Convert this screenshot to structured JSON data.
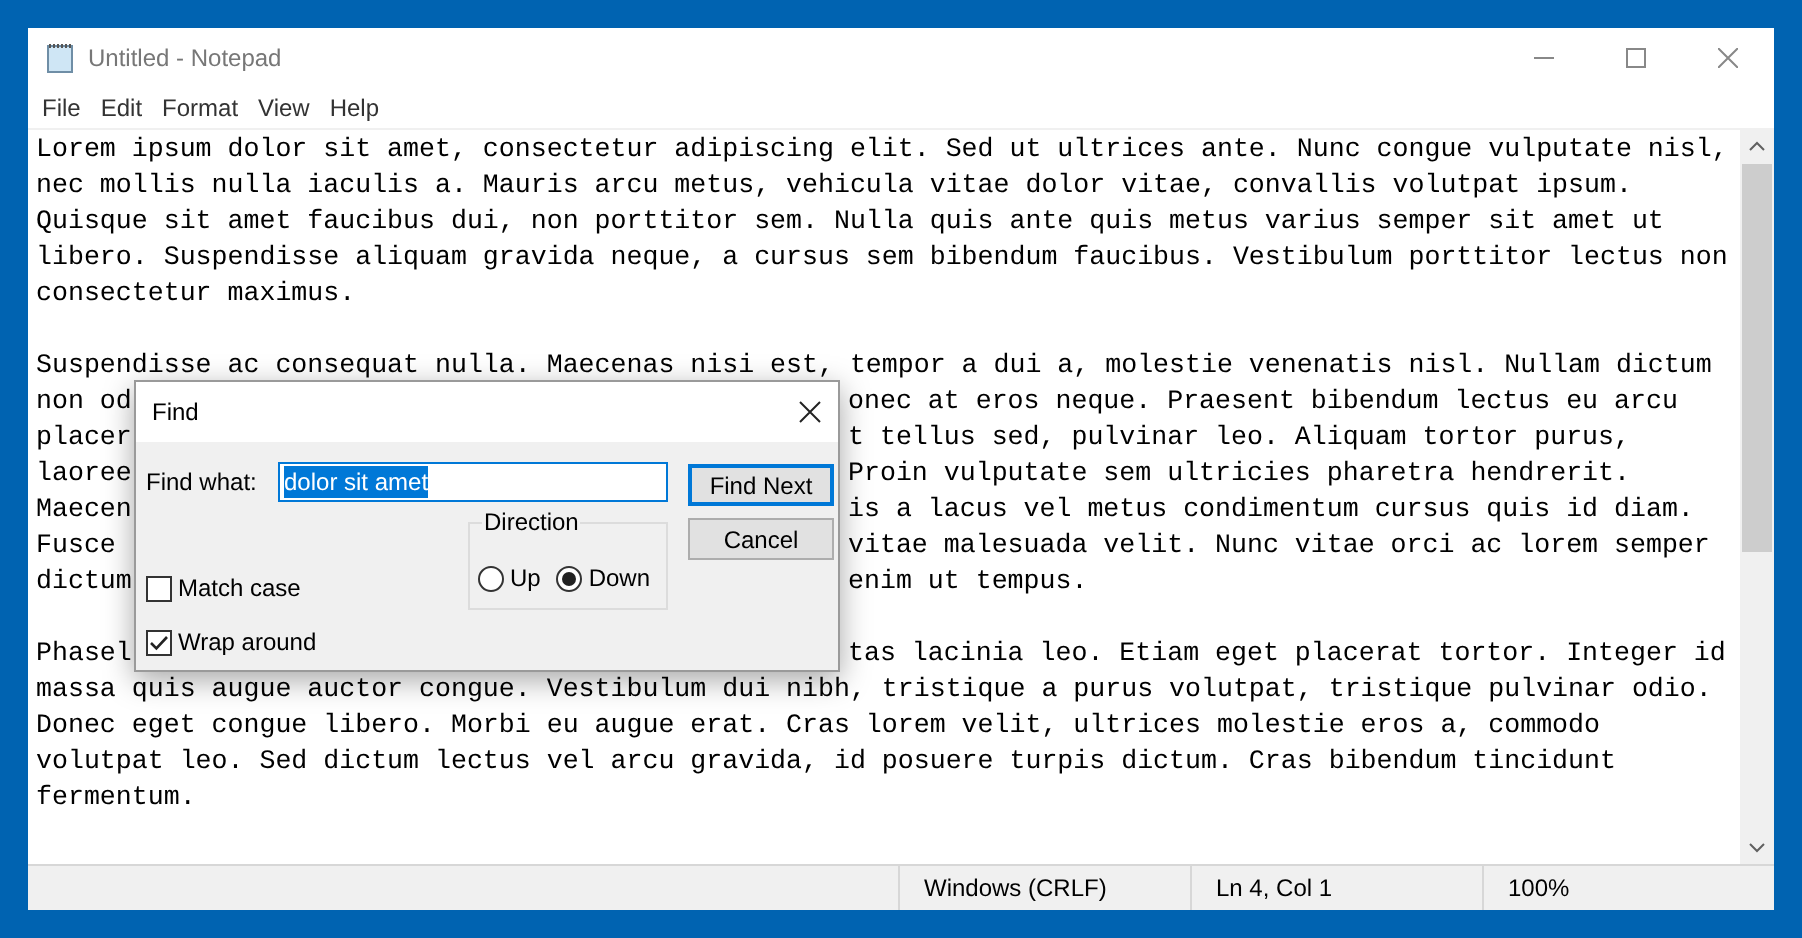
{
  "window": {
    "title": "Untitled - Notepad"
  },
  "menu": [
    "File",
    "Edit",
    "Format",
    "View",
    "Help"
  ],
  "editor": {
    "paragraphs": [
      {
        "lines": [
          {
            "text": "Lorem ipsum dolor sit amet, consectetur adipiscing elit. Sed ut ultrices ante. Nunc congue vulputate nisl,"
          },
          {
            "text": "nec mollis nulla iaculis a. Mauris arcu metus, vehicula vitae dolor vitae, convallis volutpat ipsum."
          },
          {
            "text": "Quisque sit amet faucibus dui, non porttitor sem. Nulla quis ante quis metus varius semper sit amet ut"
          },
          {
            "text": "libero. Suspendisse aliquam gravida neque, a cursus sem bibendum faucibus. Vestibulum porttitor lectus non"
          },
          {
            "text": "consectetur maximus."
          }
        ]
      },
      {
        "lines": [
          {
            "text": "Suspendisse ac consequat nulla. Maecenas nisi est, tempor a dui a, molestie venenatis nisl. Nullam dictum"
          },
          {
            "left": "non od",
            "right": "onec at eros neque. Praesent bibendum lectus eu arcu"
          },
          {
            "left": "placer",
            "right": "t tellus sed, pulvinar leo. Aliquam tortor purus,"
          },
          {
            "left": "laoree",
            "right": "Proin vulputate sem ultricies pharetra hendrerit."
          },
          {
            "left": "Maecen",
            "right": "is a lacus vel metus condimentum cursus quis id diam."
          },
          {
            "left": "Fusce",
            "right": "vitae malesuada velit. Nunc vitae orci ac lorem semper"
          },
          {
            "left": "dictum",
            "right": "enim ut tempus."
          }
        ]
      },
      {
        "lines": [
          {
            "left": "Phasel",
            "right": "tas lacinia leo. Etiam eget placerat tortor. Integer id"
          },
          {
            "text": "massa quis augue auctor congue. Vestibulum dui nibh, tristique a purus volutpat, tristique pulvinar odio."
          },
          {
            "text": "Donec eget congue libero. Morbi eu augue erat. Cras lorem velit, ultrices molestie eros a, commodo"
          },
          {
            "text": "volutpat leo. Sed dictum lectus vel arcu gravida, id posuere turpis dictum. Cras bibendum tincidunt"
          },
          {
            "text": "fermentum."
          }
        ]
      }
    ]
  },
  "find_dialog": {
    "title": "Find",
    "find_label": "Find what:",
    "find_value": "dolor sit amet",
    "value_selected": true,
    "buttons": [
      {
        "label": "Find Next",
        "focused": true
      },
      {
        "label": "Cancel",
        "focused": false
      }
    ],
    "direction": {
      "label": "Direction",
      "options": [
        {
          "label": "Up",
          "selected": false
        },
        {
          "label": "Down",
          "selected": true
        }
      ]
    },
    "checkboxes": [
      {
        "label": "Match case",
        "checked": false
      },
      {
        "label": "Wrap around",
        "checked": true
      }
    ]
  },
  "status_bar": [
    "Windows (CRLF)",
    "Ln 4, Col 1",
    "100%"
  ]
}
